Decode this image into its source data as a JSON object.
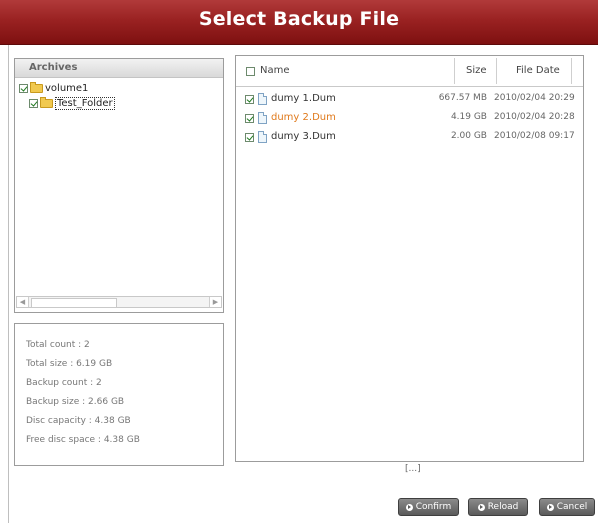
{
  "title": "Select Backup File",
  "archives": {
    "header": "Archives",
    "tree": [
      {
        "label": "volume1",
        "checked": true
      },
      {
        "label": "Test_Folder",
        "checked": true
      }
    ]
  },
  "info": {
    "lines": [
      "Total count : 2",
      "Total size : 6.19 GB",
      "Backup count : 2",
      "Backup size : 2.66 GB",
      "Disc capacity : 4.38 GB",
      "Free disc space : 4.38 GB"
    ]
  },
  "files": {
    "columns": {
      "name": "Name",
      "size": "Size",
      "date": "File Date"
    },
    "rows": [
      {
        "name": "dumy 1.Dum",
        "size": "667.57 MB",
        "date": "2010/02/04 20:29",
        "checked": true,
        "highlight": false
      },
      {
        "name": "dumy 2.Dum",
        "size": "4.19 GB",
        "date": "2010/02/04 20:28",
        "checked": true,
        "highlight": true
      },
      {
        "name": "dumy 3.Dum",
        "size": "2.00 GB",
        "date": "2010/02/08 09:17",
        "checked": true,
        "highlight": false
      }
    ]
  },
  "pager": "[...]",
  "buttons": {
    "confirm": "Confirm",
    "reload": "Reload",
    "cancel": "Cancel"
  },
  "colors": {
    "title_bar": "#9a2222",
    "highlight_text": "#e07a1c"
  }
}
